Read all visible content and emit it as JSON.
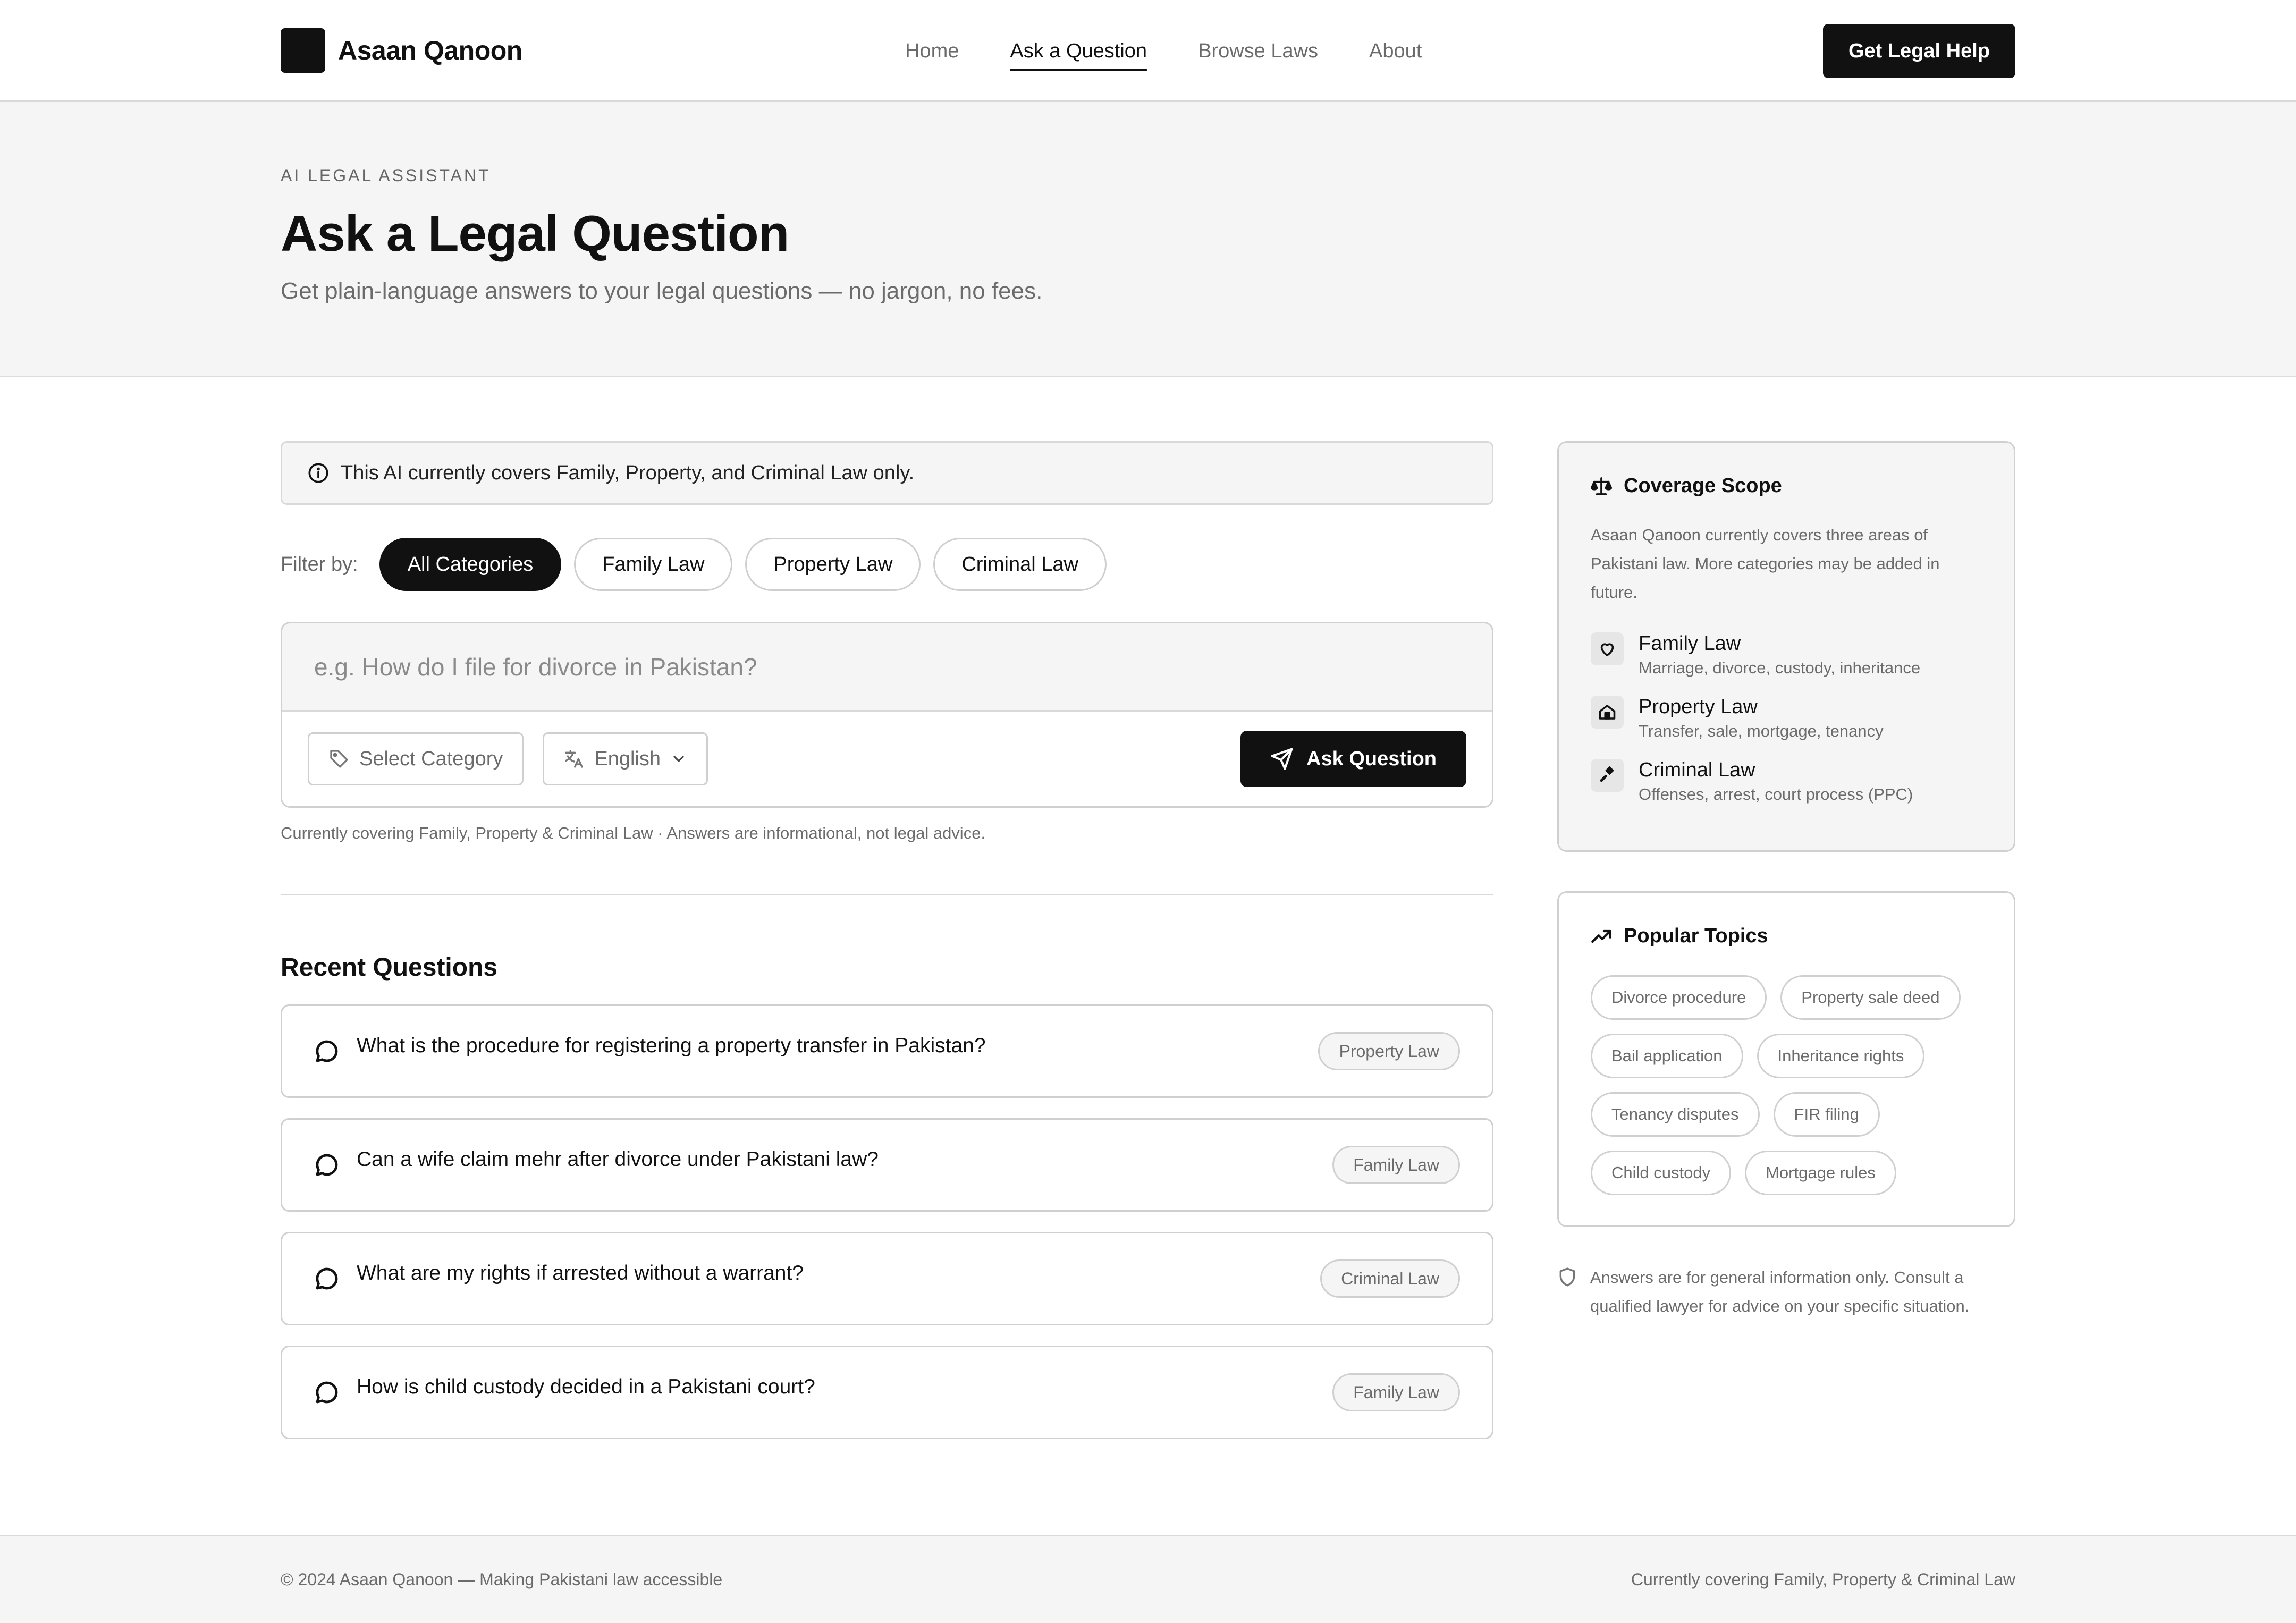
{
  "brand": {
    "name": "Asaan Qanoon"
  },
  "nav": {
    "items": [
      {
        "label": "Home",
        "active": false
      },
      {
        "label": "Ask a Question",
        "active": true
      },
      {
        "label": "Browse Laws",
        "active": false
      },
      {
        "label": "About",
        "active": false
      }
    ],
    "cta_label": "Get Legal Help"
  },
  "hero": {
    "eyebrow": "AI LEGAL ASSISTANT",
    "title": "Ask a Legal Question",
    "subtitle": "Get plain-language answers to your legal questions — no jargon, no fees."
  },
  "notice": {
    "icon": "info-icon",
    "text": "This AI currently covers Family, Property, and Criminal Law only."
  },
  "filters": {
    "label": "Filter by:",
    "chips": [
      {
        "label": "All Categories",
        "active": true
      },
      {
        "label": "Family Law",
        "active": false
      },
      {
        "label": "Property Law",
        "active": false
      },
      {
        "label": "Criminal Law",
        "active": false
      }
    ]
  },
  "ask": {
    "placeholder": "e.g. How do I file for divorce in Pakistan?",
    "value": "",
    "category_label": "Select Category",
    "language_label": "English",
    "submit_label": "Ask Question",
    "helper": "Currently covering Family, Property & Criminal Law · Answers are informational, not legal advice."
  },
  "recent": {
    "title": "Recent Questions",
    "items": [
      {
        "question": "What is the procedure for registering a property transfer in Pakistan?",
        "tag": "Property Law"
      },
      {
        "question": "Can a wife claim mehr after divorce under Pakistani law?",
        "tag": "Family Law"
      },
      {
        "question": "What are my rights if arrested without a warrant?",
        "tag": "Criminal Law"
      },
      {
        "question": "How is child custody decided in a Pakistani court?",
        "tag": "Family Law"
      }
    ]
  },
  "coverage": {
    "title": "Coverage Scope",
    "icon": "scales-icon",
    "description": "Asaan Qanoon currently covers three areas of Pakistani law. More categories may be added in future.",
    "items": [
      {
        "name": "Family Law",
        "sub": "Marriage, divorce, custody, inheritance",
        "icon": "heart-icon"
      },
      {
        "name": "Property Law",
        "sub": "Transfer, sale, mortgage, tenancy",
        "icon": "home-icon"
      },
      {
        "name": "Criminal Law",
        "sub": "Offenses, arrest, court process (PPC)",
        "icon": "gavel-icon"
      }
    ]
  },
  "popular": {
    "title": "Popular Topics",
    "icon": "trending-up-icon",
    "topics": [
      "Divorce procedure",
      "Property sale deed",
      "Bail application",
      "Inheritance rights",
      "Tenancy disputes",
      "FIR filing",
      "Child custody",
      "Mortgage rules"
    ]
  },
  "disclaimer": {
    "icon": "shield-icon",
    "text": "Answers are for general information only. Consult a qualified lawyer for advice on your specific situation."
  },
  "footer": {
    "left": "© 2024 Asaan Qanoon — Making Pakistani law accessible",
    "right": "Currently covering Family, Property & Criminal Law"
  },
  "colors": {
    "primary": "#111111",
    "muted": "#6b6b6b",
    "surface": "#f5f5f5",
    "border": "#d0d0d0"
  }
}
